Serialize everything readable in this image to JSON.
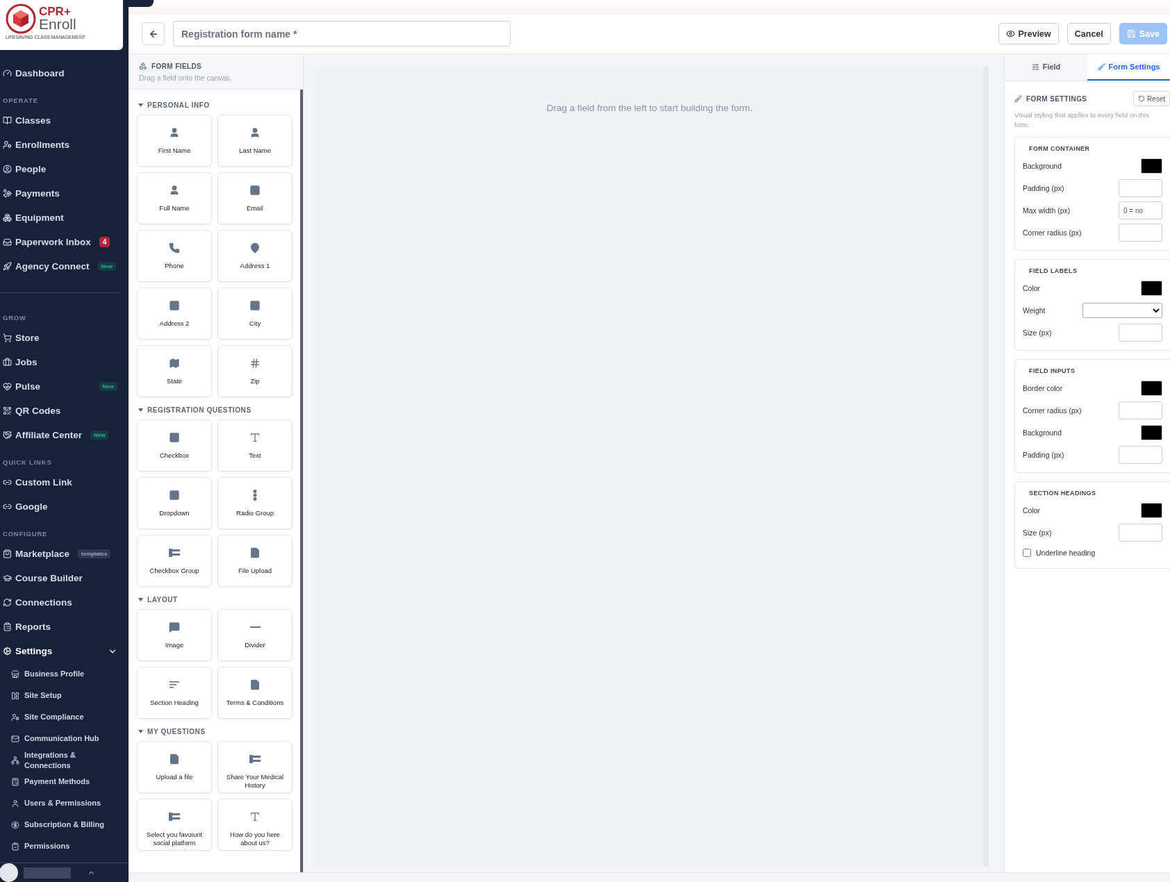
{
  "logo": {
    "brand_top": "CPR+",
    "brand_bottom": "Enroll",
    "tagline": "LIFESAVING CLASS MANAGEMENT"
  },
  "sidebar": {
    "sections": [
      {
        "items": [
          {
            "label": "Dashboard",
            "selected": false
          }
        ]
      },
      {
        "heading": "OPERATE",
        "items": [
          {
            "label": "Classes",
            "selected": false
          },
          {
            "label": "Enrollments",
            "selected": false
          },
          {
            "label": "People",
            "selected": false
          },
          {
            "label": "Payments",
            "selected": false
          },
          {
            "label": "Equipment",
            "selected": false
          },
          {
            "label": "Paperwork Inbox",
            "selected": false,
            "badge": {
              "text": "4",
              "kind": "count"
            }
          },
          {
            "label": "Agency Connect",
            "selected": false,
            "badge": {
              "text": "New",
              "kind": "new"
            }
          }
        ]
      },
      {
        "heading": "GROW",
        "items": [
          {
            "label": "Store",
            "selected": false
          },
          {
            "label": "Jobs",
            "selected": false
          },
          {
            "label": "Pulse",
            "selected": false,
            "badge": {
              "text": "New",
              "kind": "new"
            }
          },
          {
            "label": "QR Codes",
            "selected": false
          },
          {
            "label": "Affiliate Center",
            "selected": false,
            "badge": {
              "text": "New",
              "kind": "new"
            }
          }
        ]
      },
      {
        "heading": "QUICK LINKS",
        "items": [
          {
            "label": "Custom Link",
            "selected": false
          },
          {
            "label": "Google",
            "selected": false
          }
        ]
      },
      {
        "heading": "CONFIGURE",
        "items": [
          {
            "label": "Marketplace",
            "selected": false,
            "badge": {
              "text": "templates",
              "kind": "tag"
            }
          },
          {
            "label": "Course Builder",
            "selected": false
          },
          {
            "label": "Connections",
            "selected": false
          },
          {
            "label": "Reports",
            "selected": false
          },
          {
            "label": "Settings",
            "selected": true,
            "expanded": true,
            "children": [
              {
                "label": "Business Profile"
              },
              {
                "label": "Site Setup"
              },
              {
                "label": "Site Compliance"
              },
              {
                "label": "Communication Hub"
              },
              {
                "label": "Integrations & Connections"
              },
              {
                "label": "Payment Methods"
              },
              {
                "label": "Users & Permissions"
              },
              {
                "label": "Subscription & Billing"
              },
              {
                "label": "Permissions"
              }
            ]
          }
        ]
      }
    ]
  },
  "header": {
    "form_name_placeholder": "Registration form name *",
    "buttons": [
      {
        "label": "Preview",
        "kind": "outline",
        "disabled": false
      },
      {
        "label": "Cancel",
        "kind": "outline",
        "disabled": false
      },
      {
        "label": "Save",
        "kind": "primary",
        "disabled": true
      }
    ]
  },
  "form_fields": {
    "title": "FORM FIELDS",
    "subtitle": "Drag a field onto the canvas.",
    "groups": [
      {
        "title": "PERSONAL INFO",
        "expanded": true,
        "fields": [
          {
            "label": "First Name"
          },
          {
            "label": "Last Name"
          },
          {
            "label": "Full Name"
          },
          {
            "label": "Email"
          },
          {
            "label": "Phone"
          },
          {
            "label": "Address 1"
          },
          {
            "label": "Address 2"
          },
          {
            "label": "City"
          },
          {
            "label": "State"
          },
          {
            "label": "Zip"
          }
        ]
      },
      {
        "title": "REGISTRATION QUESTIONS",
        "expanded": true,
        "fields": [
          {
            "label": "Checkbox"
          },
          {
            "label": "Text"
          },
          {
            "label": "Dropdown"
          },
          {
            "label": "Radio Group"
          },
          {
            "label": "Checkbox Group"
          },
          {
            "label": "File Upload"
          }
        ]
      },
      {
        "title": "LAYOUT",
        "expanded": true,
        "fields": [
          {
            "label": "Image"
          },
          {
            "label": "Divider"
          },
          {
            "label": "Section Heading"
          },
          {
            "label": "Terms & Conditions"
          }
        ]
      },
      {
        "title": "MY QUESTIONS",
        "expanded": true,
        "fields": [
          {
            "label": "Upload a file"
          },
          {
            "label": "Share Your Medical History"
          },
          {
            "label": "Select you favoiurit social platform"
          },
          {
            "label": "How do you here about us?"
          }
        ]
      }
    ]
  },
  "canvas": {
    "empty_message": "Drag a field from the left to start building the form."
  },
  "settings_panel": {
    "tabs": [
      {
        "label": "Field",
        "selected": false
      },
      {
        "label": "Form Settings",
        "selected": true
      }
    ],
    "title": "FORM SETTINGS",
    "reset_label": "Reset",
    "description": "Visual styling that applies to every field on this form.",
    "groups": [
      {
        "title": "FORM CONTAINER",
        "rows": [
          {
            "kind": "color",
            "label": "Background",
            "color": "#000000"
          },
          {
            "kind": "number",
            "label": "Padding (px)"
          },
          {
            "kind": "number",
            "label": "Max width (px)",
            "placeholder": "0 = no"
          },
          {
            "kind": "number",
            "label": "Corner radius (px)"
          }
        ]
      },
      {
        "title": "FIELD LABELS",
        "rows": [
          {
            "kind": "color",
            "label": "Color",
            "color": "#000000"
          },
          {
            "kind": "select",
            "label": "Weight"
          },
          {
            "kind": "number",
            "label": "Size (px)"
          }
        ]
      },
      {
        "title": "FIELD INPUTS",
        "rows": [
          {
            "kind": "color",
            "label": "Border color",
            "color": "#000000"
          },
          {
            "kind": "number",
            "label": "Corner radius (px)"
          },
          {
            "kind": "color",
            "label": "Background",
            "color": "#000000"
          },
          {
            "kind": "number",
            "label": "Padding (px)"
          }
        ]
      },
      {
        "title": "SECTION HEADINGS",
        "rows": [
          {
            "kind": "color",
            "label": "Color",
            "color": "#000000"
          },
          {
            "kind": "number",
            "label": "Size (px)"
          },
          {
            "kind": "checkbox",
            "label": "Underline heading",
            "checked": false
          }
        ]
      }
    ]
  }
}
